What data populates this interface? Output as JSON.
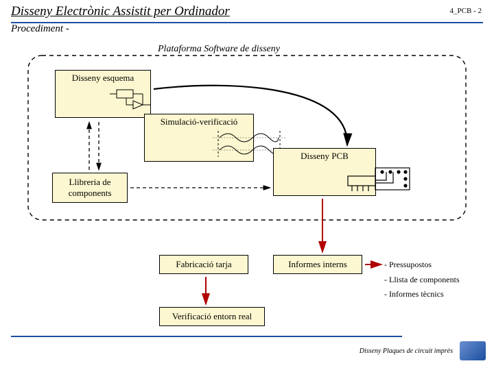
{
  "header": {
    "title": "Disseny Electrònic Assistit per Ordinador",
    "slide_no": "4_PCB - 2",
    "subtitle": "Procediment -"
  },
  "platform_title": "Plataforma Software de disseny",
  "boxes": {
    "esquema": "Disseny esquema",
    "simulacio": "Simulació-verificació",
    "pcb": "Disseny PCB",
    "llibreria": "Llibreria de\ncomponents",
    "fabricacio": "Fabricació tarja",
    "informes": "Informes interns",
    "verificacio": "Verificació entorn real"
  },
  "notes": {
    "n1": "- Pressupostos",
    "n2": "- Llista de components",
    "n3": "- Informes tècnics"
  },
  "footer": "Disseny Plaques de circuit imprès"
}
